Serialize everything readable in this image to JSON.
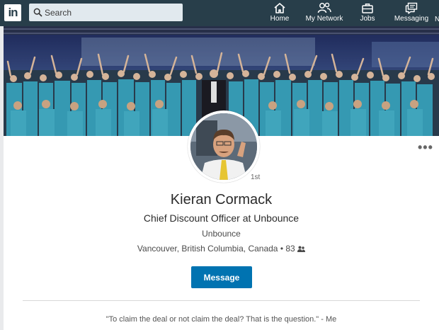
{
  "nav": {
    "logo": "in",
    "search_placeholder": "Search",
    "items": [
      {
        "label": "Home",
        "icon": "home-icon"
      },
      {
        "label": "My Network",
        "icon": "network-icon"
      },
      {
        "label": "Jobs",
        "icon": "briefcase-icon"
      },
      {
        "label": "Messaging",
        "icon": "messaging-icon"
      }
    ]
  },
  "profile": {
    "name": "Kieran Cormack",
    "headline": "Chief Discount Officer at Unbounce",
    "company": "Unbounce",
    "location": "Vancouver, British Columbia, Canada",
    "connections": "• 83",
    "degree": "1st",
    "more_label": "•••",
    "message_button": "Message",
    "summary": "\"To claim the deal or not claim the deal? That is the question.\" - Me"
  },
  "colors": {
    "nav_bg": "#283e4a",
    "primary_button": "#0073b1",
    "banner_teal": "#3aa7c2"
  }
}
